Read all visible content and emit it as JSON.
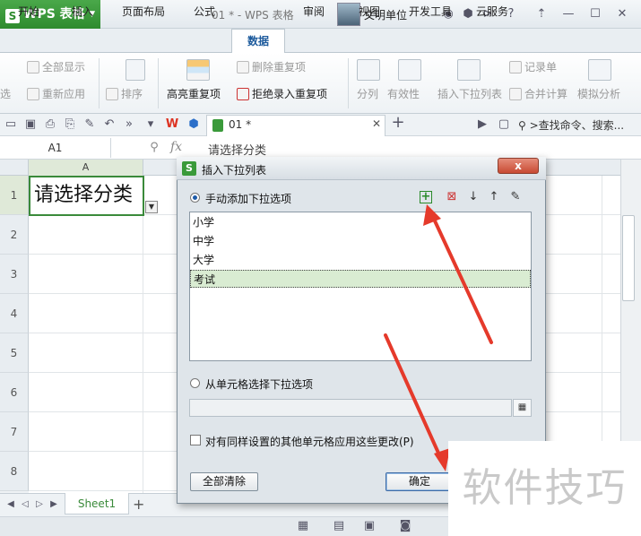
{
  "app": {
    "name": "WPS 表格",
    "doc_title": "01 * - WPS 表格",
    "user": "文明单位"
  },
  "menu": {
    "tabs": [
      "开始",
      "插入",
      "页面布局",
      "公式",
      "数据",
      "审阅",
      "视图",
      "开发工具",
      "云服务"
    ],
    "active": "数据"
  },
  "ribbon": {
    "filter_show_all": "全部显示",
    "filter_reapply": "重新应用",
    "filter_partial": "选",
    "sort": "排序",
    "highlight_dup": "高亮重复项",
    "delete_dup": "删除重复项",
    "reject_dup": "拒绝录入重复项",
    "split": "分列",
    "validity": "有效性",
    "insert_dropdown": "插入下拉列表",
    "record": "记录单",
    "merge_calc": "合并计算",
    "simulate": "模拟分析"
  },
  "toolbar": {
    "doc_tab": "01 *",
    "search": ">查找命令、搜索..."
  },
  "formula_bar": {
    "name_box": "A1",
    "fx": "fx",
    "value": "请选择分类"
  },
  "sheet": {
    "column_a": "A",
    "rows": [
      "1",
      "2",
      "3",
      "4",
      "5",
      "6",
      "7",
      "8"
    ],
    "a1": "请选择分类",
    "tab": "Sheet1"
  },
  "dialog": {
    "title": "插入下拉列表",
    "close": "x",
    "option_manual": "手动添加下拉选项",
    "items": [
      "小学",
      "中学",
      "大学",
      "考试"
    ],
    "selected_item": "考试",
    "option_from_cells": "从单元格选择下拉选项",
    "apply_all": "对有同样设置的其他单元格应用这些更改(P)",
    "clear_all": "全部清除",
    "ok": "确定"
  },
  "watermark": "软件技巧",
  "colors": {
    "brand_green": "#2e8b2e",
    "arrow_red": "#e53a2b",
    "selection_fill": "#d9ecd2"
  },
  "icons": [
    "wps-logo-icon",
    "add-item-icon",
    "delete-item-icon",
    "move-down-icon",
    "move-up-icon",
    "edit-icon",
    "range-select-icon",
    "dropdown-arrow-icon"
  ]
}
